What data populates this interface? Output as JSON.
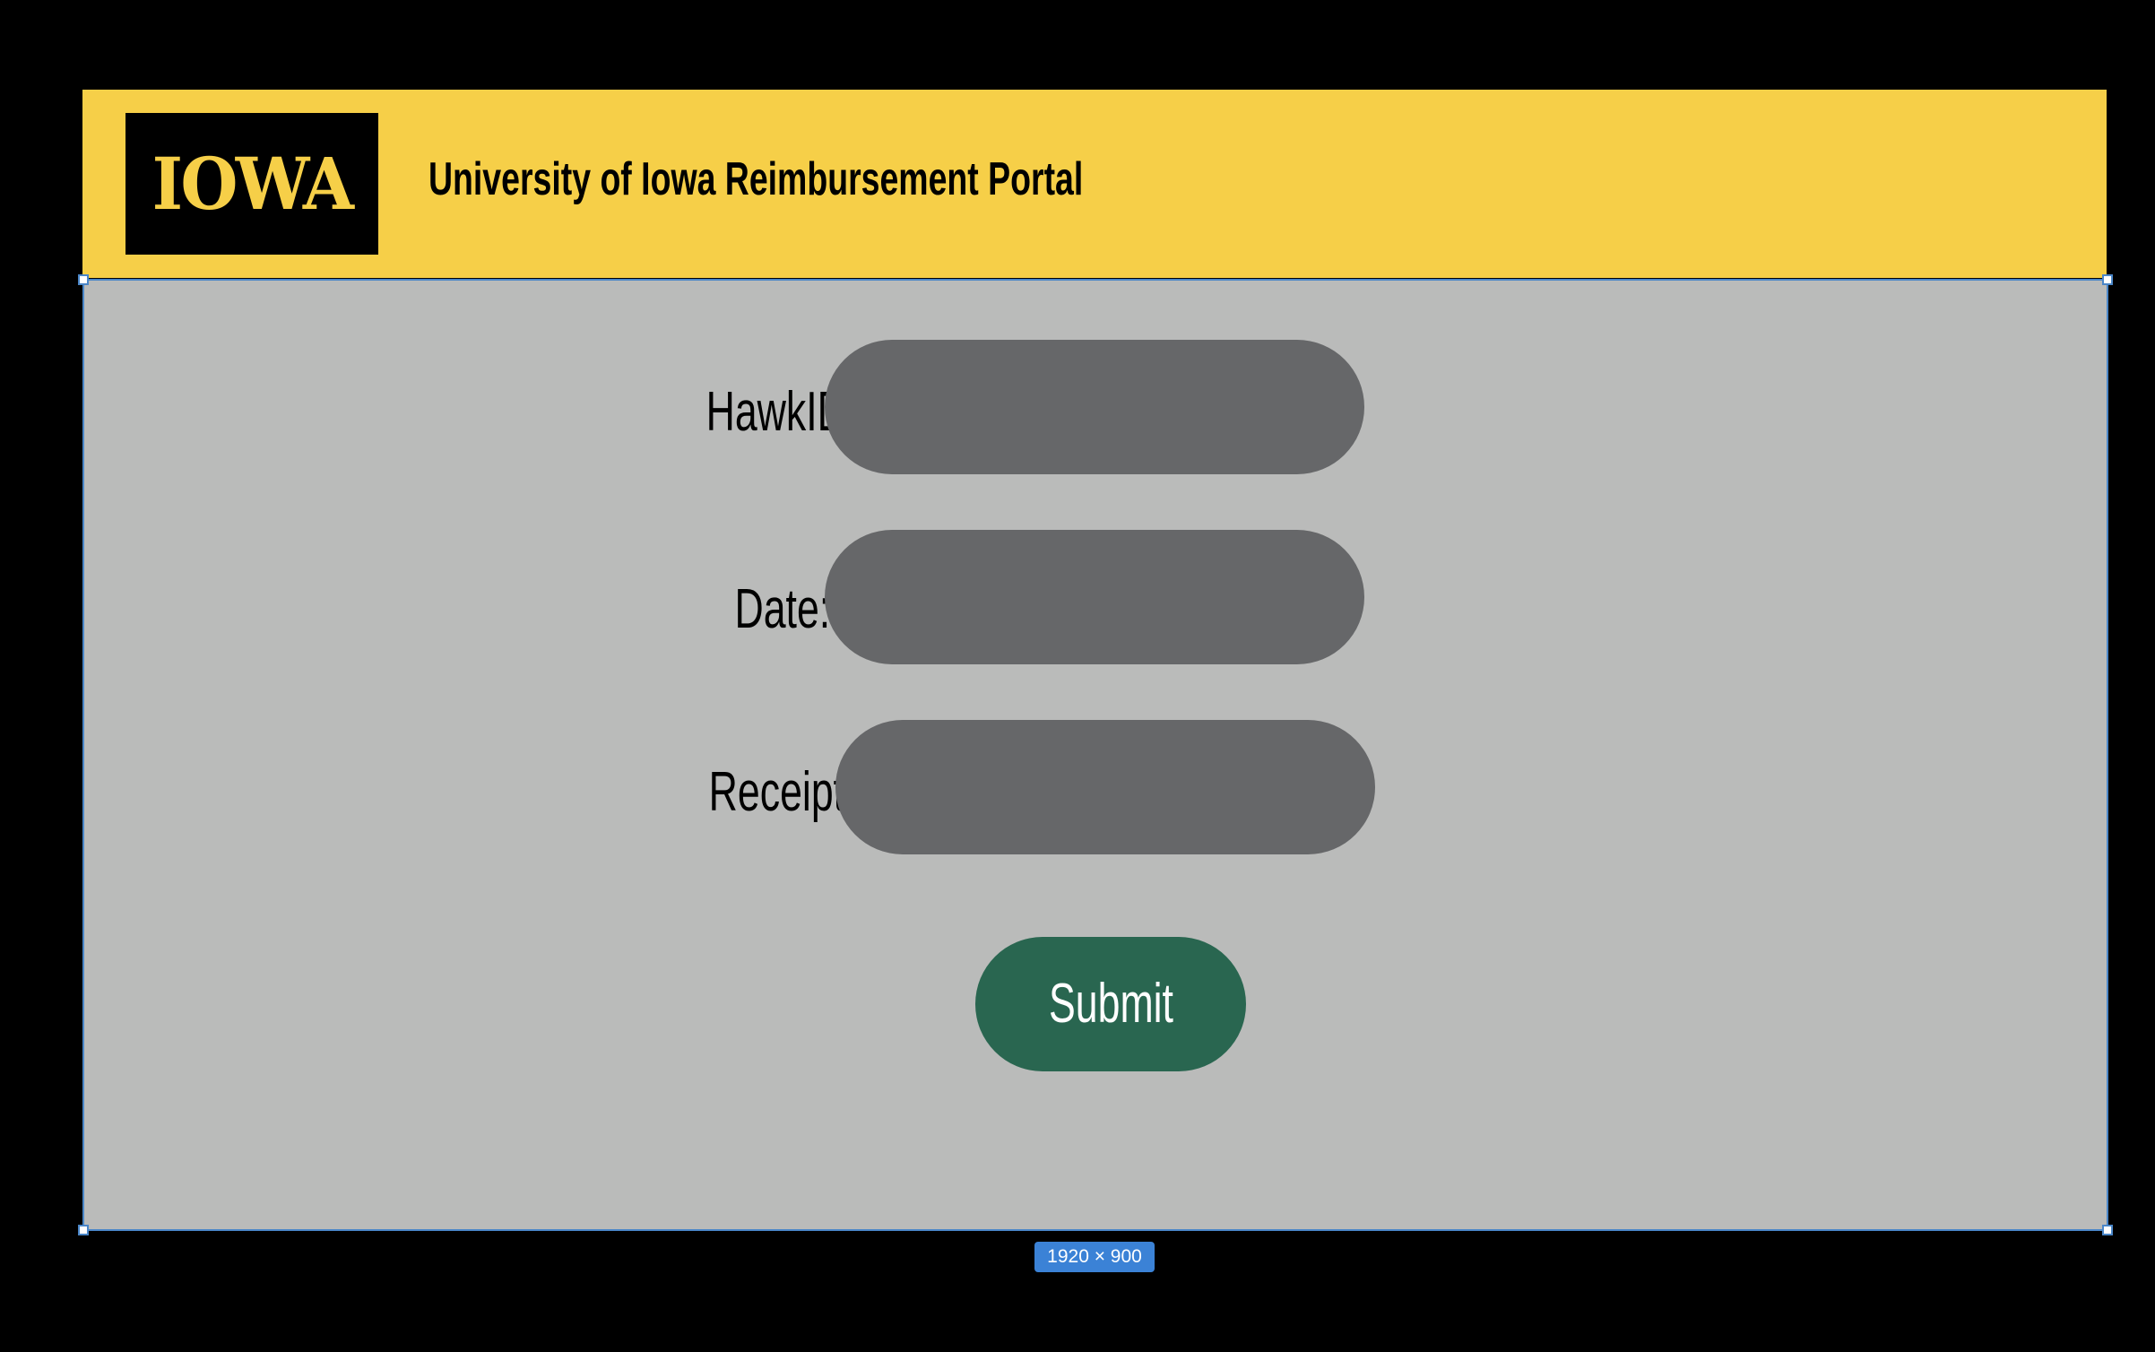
{
  "header": {
    "logo_text": "IOWA",
    "title": "University of Iowa Reimbursement Portal"
  },
  "form": {
    "hawkid_label": "HawkID:",
    "hawkid_value": "",
    "date_label": "Date:",
    "date_value": "",
    "receipt_label": "Receipt:",
    "receipt_value": "",
    "submit_label": "Submit"
  },
  "frame": {
    "size_label": "1920 × 900"
  },
  "colors": {
    "header_bg": "#f6cf48",
    "logo_bg": "#000000",
    "canvas_bg": "#babbba",
    "input_bg": "#666769",
    "submit_bg": "#296650",
    "selection": "#4a86c8",
    "badge": "#3b82d6"
  }
}
